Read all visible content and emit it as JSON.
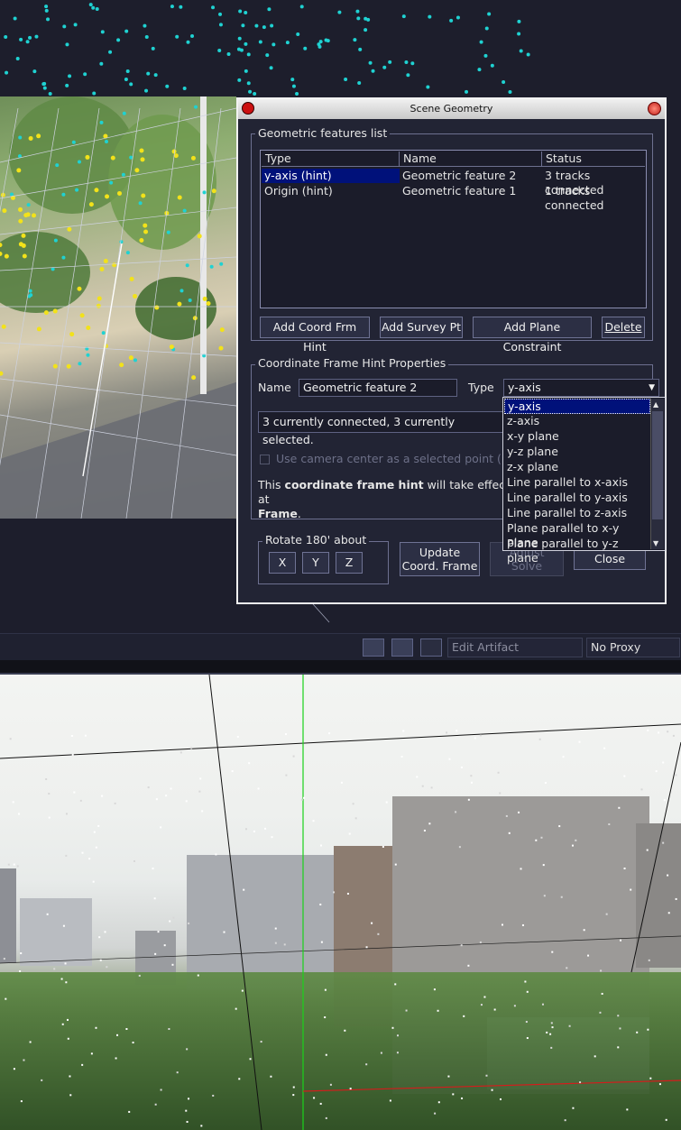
{
  "dialog": {
    "title": "Scene Geometry",
    "features_group_label": "Geometric features list",
    "columns": [
      "Type",
      "Name",
      "Status"
    ],
    "rows": [
      {
        "type": "y-axis (hint)",
        "name": "Geometric feature 2",
        "status": "3 tracks connected",
        "selected": true
      },
      {
        "type": "Origin (hint)",
        "name": "Geometric feature 1",
        "status": "1 tracks connected",
        "selected": false
      }
    ],
    "buttons": {
      "add_coord": "Add Coord Frm Hint",
      "add_survey": "Add Survey Pt",
      "add_plane": "Add Plane Constraint",
      "delete": "Delete"
    },
    "props": {
      "group_label": "Coordinate Frame Hint Properties",
      "name_label": "Name",
      "name_value": "Geometric feature 2",
      "type_label": "Type",
      "type_value": "y-axis",
      "connected_text": "3 currently connected, 3 currently selected.",
      "checkbox_label": "Use camera center as a selected point (noda",
      "info_pre": "This ",
      "info_bold1": "coordinate frame hint",
      "info_mid": " will take effect at",
      "info_bold2": "Frame",
      "info_end": "."
    },
    "rotate": {
      "label": "Rotate 180' about",
      "x": "X",
      "y": "Y",
      "z": "Z"
    },
    "update_line1": "Update",
    "update_line2": "Coord. Frame",
    "adjust_line1": "Adjust",
    "adjust_line2": "Solve",
    "close": "Close",
    "type_options": [
      "y-axis",
      "z-axis",
      "x-y plane",
      "y-z plane",
      "z-x plane",
      "Line parallel to x-axis",
      "Line parallel to y-axis",
      "Line parallel to z-axis",
      "Plane parallel to x-y plane",
      "Plane parallel to y-z plane"
    ]
  },
  "statusbar": {
    "edit_artifact": "Edit Artifact",
    "proxy": "No Proxy"
  },
  "colors": {
    "track_cyan": "#1fd2d2",
    "track_yellow": "#f2e21a",
    "selection_blue": "#00117a",
    "dialog_bg": "#222434"
  }
}
